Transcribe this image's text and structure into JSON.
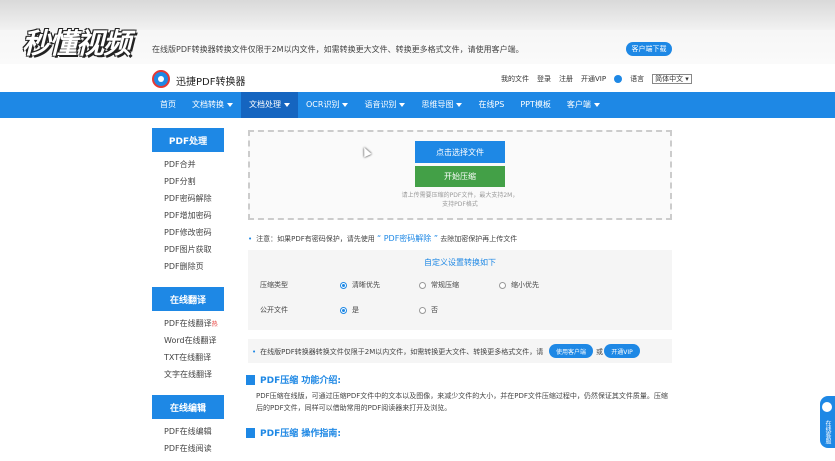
{
  "watermark": "秒懂视频",
  "topbar": {
    "notice": "在线版PDF转换器转换文件仅限于2M以内文件，如需转换更大文件、转换更多格式文件，请使用客户端。",
    "download_btn": "客户端下载"
  },
  "header": {
    "logo_text": "迅捷PDF转换器",
    "links": [
      "我的文件",
      "登录",
      "注册",
      "开通VIP"
    ],
    "lang_label": "语言",
    "lang_value": "简体中文"
  },
  "nav": {
    "items": [
      {
        "label": "首页",
        "caret": false
      },
      {
        "label": "文档转换",
        "caret": true
      },
      {
        "label": "文档处理",
        "caret": true
      },
      {
        "label": "OCR识别",
        "caret": true
      },
      {
        "label": "语音识别",
        "caret": true
      },
      {
        "label": "思维导图",
        "caret": true
      },
      {
        "label": "在线PS",
        "caret": false
      },
      {
        "label": "PPT模板",
        "caret": false
      },
      {
        "label": "客户端",
        "caret": true
      }
    ],
    "active_index": 2
  },
  "sidebar": {
    "sections": [
      {
        "title": "PDF处理",
        "items": [
          "PDF合并",
          "PDF分割",
          "PDF密码解除",
          "PDF增加密码",
          "PDF修改密码",
          "PDF图片获取",
          "PDF删除页"
        ]
      },
      {
        "title": "在线翻译",
        "items": [
          "PDF在线翻译",
          "Word在线翻译",
          "TXT在线翻译",
          "文字在线翻译"
        ]
      },
      {
        "title": "在线编辑",
        "items": [
          "PDF在线编辑",
          "PDF在线阅读"
        ]
      }
    ],
    "hot_badge": "热"
  },
  "upload": {
    "choose_btn": "点击选择文件",
    "start_btn": "开始压缩",
    "tip_line1": "请上传需要压缩的PDF文件，最大支持2M，",
    "tip_line2": "支持PDF格式"
  },
  "note1": {
    "prefix": "注意：如果PDF有密码保护，请先使用",
    "link": "“ PDF密码解除 ”",
    "suffix": "去除加密保护再上传文件"
  },
  "settings": {
    "title": "自定义设置转换如下",
    "compress_label": "压缩类型",
    "compress_options": [
      "清晰优先",
      "常规压缩",
      "缩小优先"
    ],
    "compress_selected": 0,
    "public_label": "公开文件",
    "public_options": [
      "是",
      "否"
    ],
    "public_selected": 0
  },
  "note2": {
    "text": "在线版PDF转换器转换文件仅限于2M以内文件，如需转换更大文件、转换更多格式文件，请",
    "btn_client": "使用客户端",
    "or": "或",
    "btn_vip": "开通VIP"
  },
  "intro": {
    "title": "PDF压缩 功能介绍:",
    "line1": "PDF压缩在线版，可通过压缩PDF文件中的文本以及图像，来减少文件的大小，并在PDF文件压缩过程中，仍然保证其文件质量。压缩",
    "line2": "后的PDF文件，同样可以借助常用的PDF阅读器来打开及浏览。"
  },
  "guide": {
    "title": "PDF压缩 操作指南:"
  },
  "float_service": "在线客服"
}
